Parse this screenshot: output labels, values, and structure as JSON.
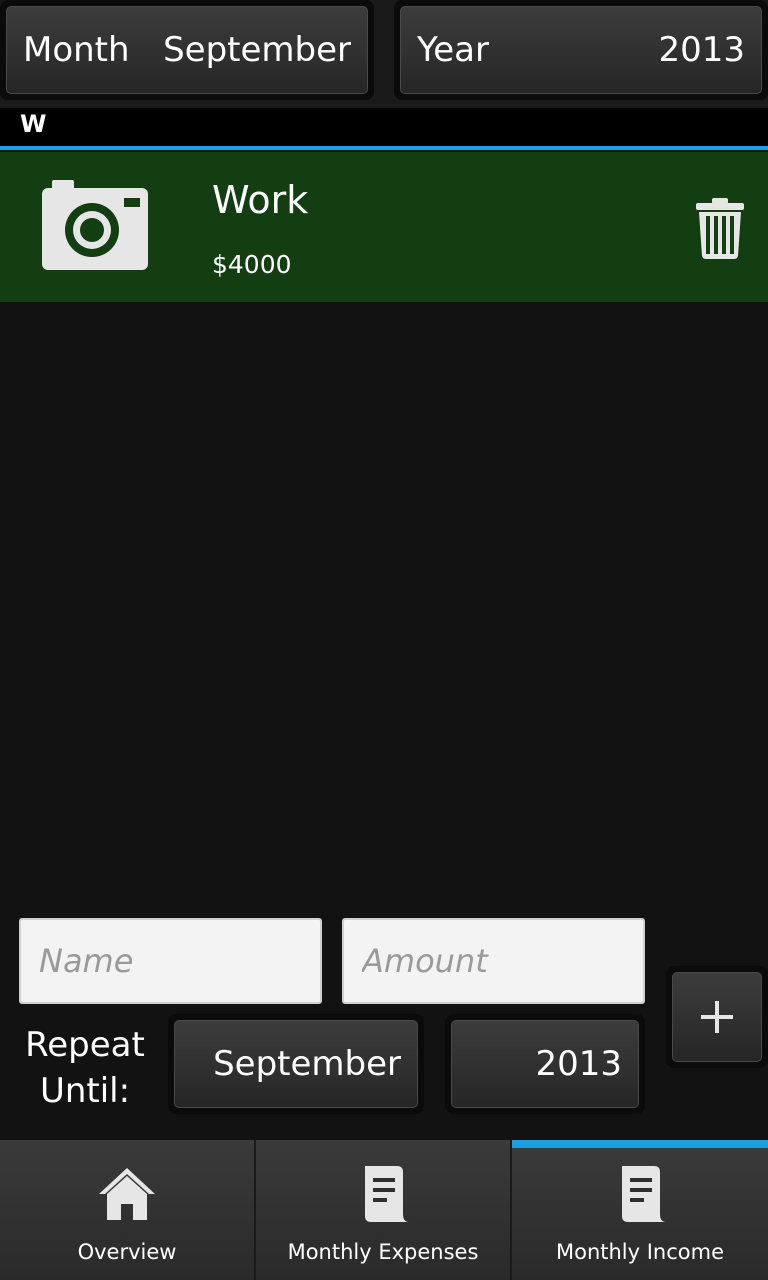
{
  "header": {
    "month": {
      "label": "Month",
      "value": "September"
    },
    "year": {
      "label": "Year",
      "value": "2013"
    }
  },
  "list": {
    "section_letter": "W",
    "items": [
      {
        "title": "Work",
        "amount": "$4000",
        "icon": "camera-icon",
        "background": "#123e11"
      }
    ]
  },
  "form": {
    "name_placeholder": "Name",
    "amount_placeholder": "Amount",
    "repeat_label": "Repeat Until:",
    "repeat_month": "September",
    "repeat_year": "2013",
    "add_icon": "plus-icon"
  },
  "tabs": [
    {
      "label": "Overview",
      "icon": "home-icon",
      "active": false
    },
    {
      "label": "Monthly Expenses",
      "icon": "document-icon",
      "active": false
    },
    {
      "label": "Monthly Income",
      "icon": "document-icon",
      "active": true
    }
  ],
  "colors": {
    "accent": "#1aa0e0",
    "row_background": "#123e11",
    "page_background": "#121212"
  }
}
